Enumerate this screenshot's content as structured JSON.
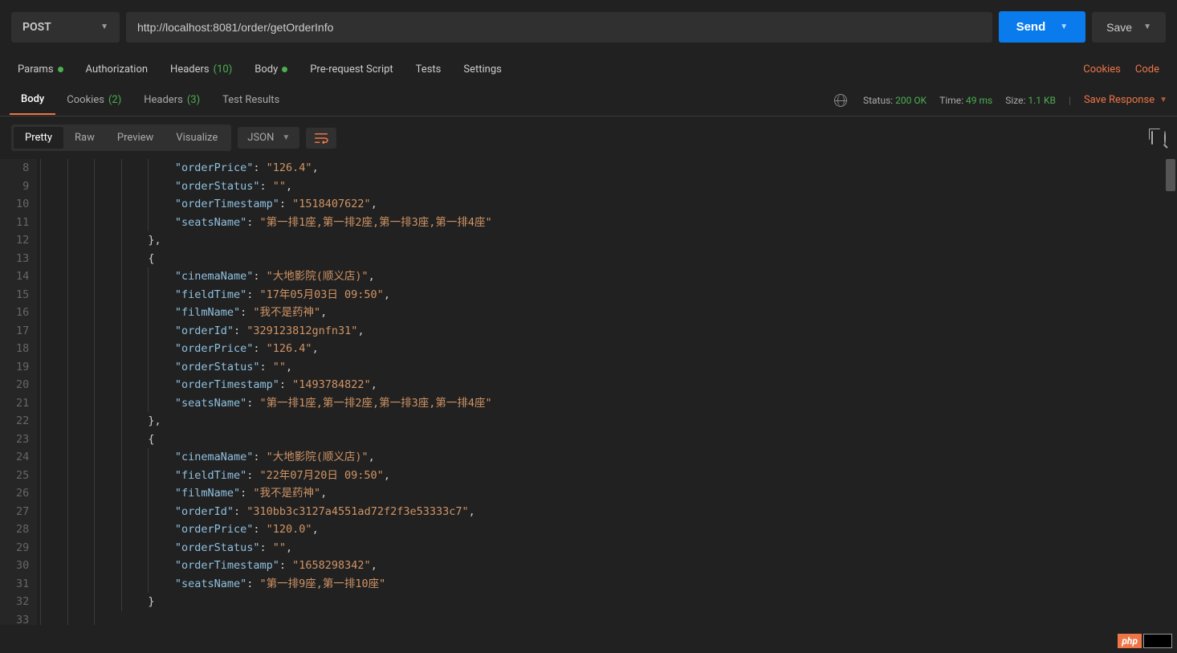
{
  "topbar": {
    "method": "POST",
    "url": "http://localhost:8081/order/getOrderInfo",
    "send": "Send",
    "save": "Save"
  },
  "reqTabs": {
    "params": "Params",
    "auth": "Authorization",
    "headers": "Headers",
    "headersCount": "(10)",
    "body": "Body",
    "prereq": "Pre-request Script",
    "tests": "Tests",
    "settings": "Settings",
    "cookies": "Cookies",
    "code": "Code"
  },
  "respTabs": {
    "body": "Body",
    "cookies": "Cookies",
    "cookiesCount": "(2)",
    "headers": "Headers",
    "headersCount": "(3)",
    "testResults": "Test Results"
  },
  "meta": {
    "statusLabel": "Status:",
    "status": "200 OK",
    "timeLabel": "Time:",
    "time": "49 ms",
    "sizeLabel": "Size:",
    "size": "1.1 KB",
    "saveResponse": "Save Response"
  },
  "format": {
    "pretty": "Pretty",
    "raw": "Raw",
    "preview": "Preview",
    "visualize": "Visualize",
    "lang": "JSON"
  },
  "code": {
    "firstLine": 8,
    "lines": [
      {
        "parts": [
          {
            "i": 5
          },
          {
            "t": "\"orderPrice\"",
            "c": "key"
          },
          {
            "t": ": ",
            "c": "punc"
          },
          {
            "t": "\"126.4\"",
            "c": "str"
          },
          {
            "t": ",",
            "c": "punc"
          }
        ]
      },
      {
        "parts": [
          {
            "i": 5
          },
          {
            "t": "\"orderStatus\"",
            "c": "key"
          },
          {
            "t": ": ",
            "c": "punc"
          },
          {
            "t": "\"\"",
            "c": "str"
          },
          {
            "t": ",",
            "c": "punc"
          }
        ]
      },
      {
        "parts": [
          {
            "i": 5
          },
          {
            "t": "\"orderTimestamp\"",
            "c": "key"
          },
          {
            "t": ": ",
            "c": "punc"
          },
          {
            "t": "\"1518407622\"",
            "c": "str"
          },
          {
            "t": ",",
            "c": "punc"
          }
        ]
      },
      {
        "parts": [
          {
            "i": 5
          },
          {
            "t": "\"seatsName\"",
            "c": "key"
          },
          {
            "t": ": ",
            "c": "punc"
          },
          {
            "t": "\"第一排1座,第一排2座,第一排3座,第一排4座\"",
            "c": "str"
          }
        ]
      },
      {
        "parts": [
          {
            "i": 4
          },
          {
            "t": "},",
            "c": "punc"
          }
        ]
      },
      {
        "parts": [
          {
            "i": 4
          },
          {
            "t": "{",
            "c": "punc"
          }
        ]
      },
      {
        "parts": [
          {
            "i": 5
          },
          {
            "t": "\"cinemaName\"",
            "c": "key"
          },
          {
            "t": ": ",
            "c": "punc"
          },
          {
            "t": "\"大地影院(顺义店)\"",
            "c": "str"
          },
          {
            "t": ",",
            "c": "punc"
          }
        ]
      },
      {
        "parts": [
          {
            "i": 5
          },
          {
            "t": "\"fieldTime\"",
            "c": "key"
          },
          {
            "t": ": ",
            "c": "punc"
          },
          {
            "t": "\"17年05月03日 09:50\"",
            "c": "str"
          },
          {
            "t": ",",
            "c": "punc"
          }
        ]
      },
      {
        "parts": [
          {
            "i": 5
          },
          {
            "t": "\"filmName\"",
            "c": "key"
          },
          {
            "t": ": ",
            "c": "punc"
          },
          {
            "t": "\"我不是药神\"",
            "c": "str"
          },
          {
            "t": ",",
            "c": "punc"
          }
        ]
      },
      {
        "parts": [
          {
            "i": 5
          },
          {
            "t": "\"orderId\"",
            "c": "key"
          },
          {
            "t": ": ",
            "c": "punc"
          },
          {
            "t": "\"329123812gnfn31\"",
            "c": "str"
          },
          {
            "t": ",",
            "c": "punc"
          }
        ]
      },
      {
        "parts": [
          {
            "i": 5
          },
          {
            "t": "\"orderPrice\"",
            "c": "key"
          },
          {
            "t": ": ",
            "c": "punc"
          },
          {
            "t": "\"126.4\"",
            "c": "str"
          },
          {
            "t": ",",
            "c": "punc"
          }
        ]
      },
      {
        "parts": [
          {
            "i": 5
          },
          {
            "t": "\"orderStatus\"",
            "c": "key"
          },
          {
            "t": ": ",
            "c": "punc"
          },
          {
            "t": "\"\"",
            "c": "str"
          },
          {
            "t": ",",
            "c": "punc"
          }
        ]
      },
      {
        "parts": [
          {
            "i": 5
          },
          {
            "t": "\"orderTimestamp\"",
            "c": "key"
          },
          {
            "t": ": ",
            "c": "punc"
          },
          {
            "t": "\"1493784822\"",
            "c": "str"
          },
          {
            "t": ",",
            "c": "punc"
          }
        ]
      },
      {
        "parts": [
          {
            "i": 5
          },
          {
            "t": "\"seatsName\"",
            "c": "key"
          },
          {
            "t": ": ",
            "c": "punc"
          },
          {
            "t": "\"第一排1座,第一排2座,第一排3座,第一排4座\"",
            "c": "str"
          }
        ]
      },
      {
        "parts": [
          {
            "i": 4
          },
          {
            "t": "},",
            "c": "punc"
          }
        ]
      },
      {
        "parts": [
          {
            "i": 4
          },
          {
            "t": "{",
            "c": "punc"
          }
        ]
      },
      {
        "parts": [
          {
            "i": 5
          },
          {
            "t": "\"cinemaName\"",
            "c": "key"
          },
          {
            "t": ": ",
            "c": "punc"
          },
          {
            "t": "\"大地影院(顺义店)\"",
            "c": "str"
          },
          {
            "t": ",",
            "c": "punc"
          }
        ]
      },
      {
        "parts": [
          {
            "i": 5
          },
          {
            "t": "\"fieldTime\"",
            "c": "key"
          },
          {
            "t": ": ",
            "c": "punc"
          },
          {
            "t": "\"22年07月20日 09:50\"",
            "c": "str"
          },
          {
            "t": ",",
            "c": "punc"
          }
        ]
      },
      {
        "parts": [
          {
            "i": 5
          },
          {
            "t": "\"filmName\"",
            "c": "key"
          },
          {
            "t": ": ",
            "c": "punc"
          },
          {
            "t": "\"我不是药神\"",
            "c": "str"
          },
          {
            "t": ",",
            "c": "punc"
          }
        ]
      },
      {
        "parts": [
          {
            "i": 5
          },
          {
            "t": "\"orderId\"",
            "c": "key"
          },
          {
            "t": ": ",
            "c": "punc"
          },
          {
            "t": "\"310bb3c3127a4551ad72f2f3e53333c7\"",
            "c": "str"
          },
          {
            "t": ",",
            "c": "punc"
          }
        ]
      },
      {
        "parts": [
          {
            "i": 5
          },
          {
            "t": "\"orderPrice\"",
            "c": "key"
          },
          {
            "t": ": ",
            "c": "punc"
          },
          {
            "t": "\"120.0\"",
            "c": "str"
          },
          {
            "t": ",",
            "c": "punc"
          }
        ]
      },
      {
        "parts": [
          {
            "i": 5
          },
          {
            "t": "\"orderStatus\"",
            "c": "key"
          },
          {
            "t": ": ",
            "c": "punc"
          },
          {
            "t": "\"\"",
            "c": "str"
          },
          {
            "t": ",",
            "c": "punc"
          }
        ]
      },
      {
        "parts": [
          {
            "i": 5
          },
          {
            "t": "\"orderTimestamp\"",
            "c": "key"
          },
          {
            "t": ": ",
            "c": "punc"
          },
          {
            "t": "\"1658298342\"",
            "c": "str"
          },
          {
            "t": ",",
            "c": "punc"
          }
        ]
      },
      {
        "parts": [
          {
            "i": 5
          },
          {
            "t": "\"seatsName\"",
            "c": "key"
          },
          {
            "t": ": ",
            "c": "punc"
          },
          {
            "t": "\"第一排9座,第一排10座\"",
            "c": "str"
          }
        ]
      },
      {
        "parts": [
          {
            "i": 4
          },
          {
            "t": "}",
            "c": "punc"
          }
        ]
      },
      {
        "parts": [
          {
            "i": 3
          }
        ]
      }
    ]
  },
  "watermark": "php"
}
